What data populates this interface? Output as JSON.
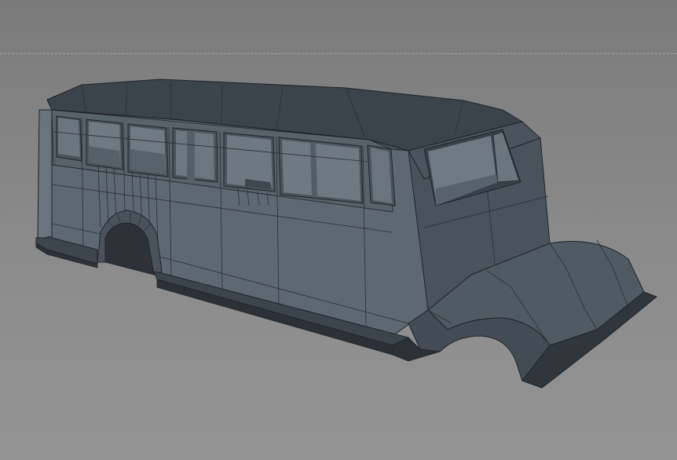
{
  "viewport": {
    "name": "3d-modeling-viewport",
    "mesh": "bus-body",
    "display_mode": "gouraud-shaded-with-wireframe",
    "colors": {
      "background_top": "#7a7a7a",
      "background_bottom": "#949494",
      "horizon_line": "#a9a9a9",
      "surface_light": "#5f6a75",
      "surface_mid": "#4f5963",
      "surface_dark": "#3a424a",
      "surface_darkest": "#2b3138",
      "wire": "#1f2327"
    }
  }
}
